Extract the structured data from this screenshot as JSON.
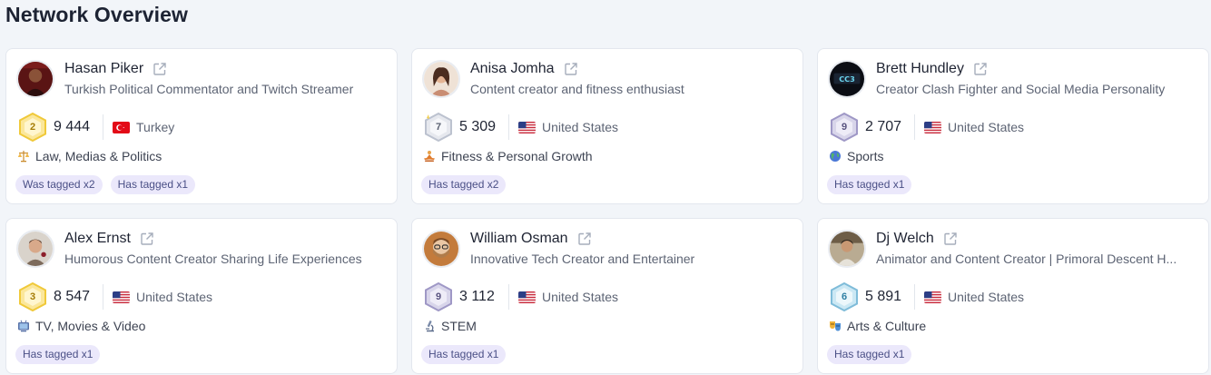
{
  "page_title": "Network Overview",
  "colors": {
    "background": "#f2f5f9",
    "card": "#ffffff",
    "tag_bg": "#ebe8fb",
    "tag_text": "#4a4f86",
    "badge_gold": "#f5d65b",
    "badge_silver": "#cfd3dc",
    "badge_purple": "#b9b3da",
    "badge_blue": "#9fd1e8"
  },
  "cards": [
    {
      "name": "Hasan Piker",
      "description": "Turkish Political Commentator and Twitch Streamer",
      "level": "2",
      "badge_icon": "gold-rank-badge-icon",
      "count": "9 444",
      "country": "Turkey",
      "flag_icon": "turkey-flag-icon",
      "category_icon": "scales-icon",
      "category": "Law, Medias & Politics",
      "tags": [
        "Was tagged x2",
        "Has tagged x1"
      ]
    },
    {
      "name": "Anisa Jomha",
      "description": "Content creator and fitness enthusiast",
      "level": "7",
      "badge_icon": "silver-rank-badge-icon",
      "count": "5 309",
      "country": "United States",
      "flag_icon": "us-flag-icon",
      "category_icon": "meditation-icon",
      "category": "Fitness & Personal Growth",
      "tags": [
        "Has tagged x2"
      ]
    },
    {
      "name": "Brett Hundley",
      "description": "Creator Clash Fighter and Social Media Personality",
      "level": "9",
      "badge_icon": "purple-rank-badge-icon",
      "count": "2 707",
      "country": "United States",
      "flag_icon": "us-flag-icon",
      "category_icon": "globe-icon",
      "category": "Sports",
      "tags": [
        "Has tagged x1"
      ]
    },
    {
      "name": "Alex Ernst",
      "description": "Humorous Content Creator Sharing Life Experiences",
      "level": "3",
      "badge_icon": "gold-rank-badge-icon",
      "count": "8 547",
      "country": "United States",
      "flag_icon": "us-flag-icon",
      "category_icon": "television-icon",
      "category": "TV, Movies & Video",
      "tags": [
        "Has tagged x1"
      ]
    },
    {
      "name": "William Osman",
      "description": "Innovative Tech Creator and Entertainer",
      "level": "9",
      "badge_icon": "purple-rank-badge-icon",
      "count": "3 112",
      "country": "United States",
      "flag_icon": "us-flag-icon",
      "category_icon": "microscope-icon",
      "category": "STEM",
      "tags": [
        "Has tagged x1"
      ]
    },
    {
      "name": "Dj Welch",
      "description": "Animator and Content Creator | Primoral Descent H...",
      "level": "6",
      "badge_icon": "blue-rank-badge-icon",
      "count": "5 891",
      "country": "United States",
      "flag_icon": "us-flag-icon",
      "category_icon": "theater-masks-icon",
      "category": "Arts & Culture",
      "tags": [
        "Has tagged x1"
      ]
    }
  ]
}
